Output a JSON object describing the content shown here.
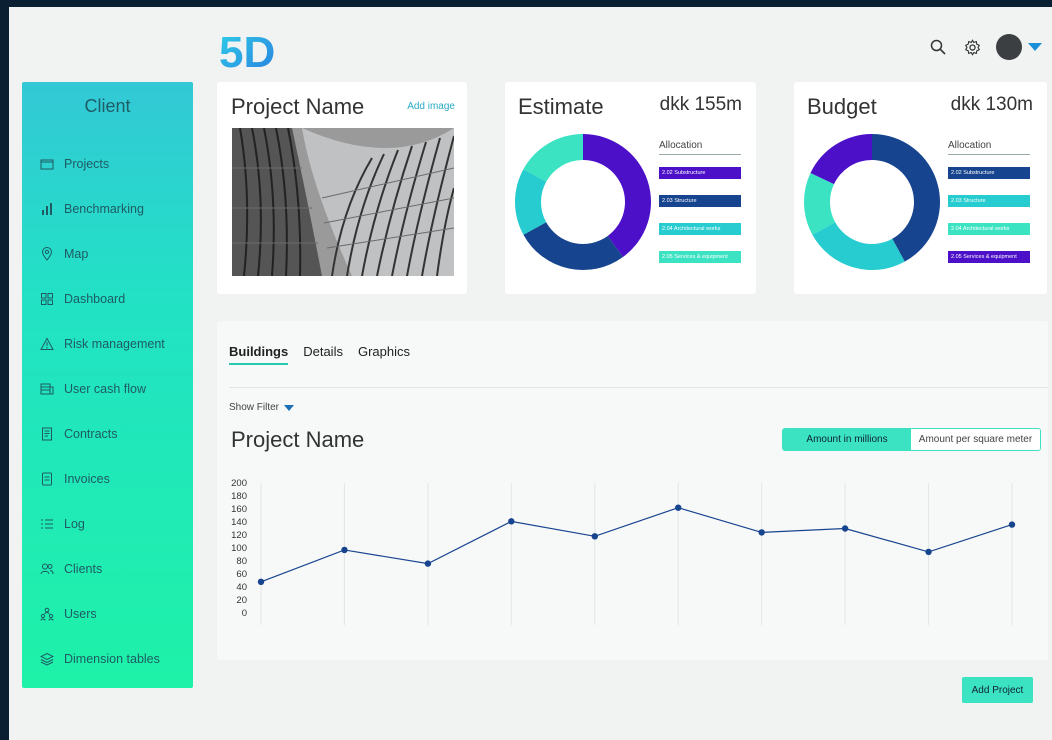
{
  "header": {
    "logo_text": "5D"
  },
  "sidebar": {
    "title": "Client",
    "items": [
      {
        "label": "Projects",
        "icon": "projects-icon"
      },
      {
        "label": "Benchmarking",
        "icon": "bar-chart-icon"
      },
      {
        "label": "Map",
        "icon": "map-pin-icon"
      },
      {
        "label": "Dashboard",
        "icon": "grid-icon"
      },
      {
        "label": "Risk management",
        "icon": "warning-icon"
      },
      {
        "label": "User cash flow",
        "icon": "cash-icon"
      },
      {
        "label": "Contracts",
        "icon": "contract-icon"
      },
      {
        "label": "Invoices",
        "icon": "invoice-icon"
      },
      {
        "label": "Log",
        "icon": "list-icon"
      },
      {
        "label": "Clients",
        "icon": "clients-icon"
      },
      {
        "label": "Users",
        "icon": "users-icon"
      },
      {
        "label": "Dimension tables",
        "icon": "layers-icon"
      }
    ]
  },
  "project_card": {
    "title": "Project Name",
    "add_image": "Add image"
  },
  "estimate": {
    "title": "Estimate",
    "amount": "dkk 155m",
    "allocation_title": "Allocation",
    "allocation": [
      {
        "label": "2.02 Substructure",
        "color": "#4b10c8"
      },
      {
        "label": "2.03 Structure",
        "color": "#17448f"
      },
      {
        "label": "2.04 Architectural works",
        "color": "#26ccd0"
      },
      {
        "label": "2.05 Services & equipment",
        "color": "#3be3c2"
      }
    ],
    "slices": [
      {
        "value": 0.4,
        "color": "#4b10c8"
      },
      {
        "value": 0.27,
        "color": "#17448f"
      },
      {
        "value": 0.16,
        "color": "#26ccd0"
      },
      {
        "value": 0.17,
        "color": "#3be3c2"
      }
    ]
  },
  "budget": {
    "title": "Budget",
    "amount": "dkk 130m",
    "allocation_title": "Allocation",
    "allocation": [
      {
        "label": "2.02 Substructure",
        "color": "#17448f"
      },
      {
        "label": "2.03 Structure",
        "color": "#26ccd0"
      },
      {
        "label": "2.04 Architectural works",
        "color": "#3be3c2"
      },
      {
        "label": "2.05 Services & equipment",
        "color": "#4b10c8"
      }
    ],
    "slices": [
      {
        "value": 0.42,
        "color": "#17448f"
      },
      {
        "value": 0.25,
        "color": "#26ccd0"
      },
      {
        "value": 0.15,
        "color": "#3be3c2"
      },
      {
        "value": 0.18,
        "color": "#4b10c8"
      }
    ]
  },
  "panel": {
    "tabs": [
      "Buildings",
      "Details",
      "Graphics"
    ],
    "active_tab": 0,
    "show_filter": "Show Filter",
    "title": "Project Name",
    "toggle_on": "Amount in millions",
    "toggle_off": "Amount per square meter"
  },
  "chart_data": {
    "type": "line",
    "title": "",
    "xlabel": "",
    "ylabel": "",
    "ylim": [
      0,
      200
    ],
    "yticks": [
      0,
      20,
      40,
      60,
      80,
      100,
      120,
      140,
      160,
      180,
      200
    ],
    "x": [
      1,
      2,
      3,
      4,
      5,
      6,
      7,
      8,
      9,
      10
    ],
    "series": [
      {
        "values": [
          48,
          97,
          76,
          141,
          118,
          162,
          124,
          130,
          94,
          136
        ],
        "color": "#17448f"
      }
    ],
    "grid": "vertical"
  },
  "add_project_label": "Add Project"
}
